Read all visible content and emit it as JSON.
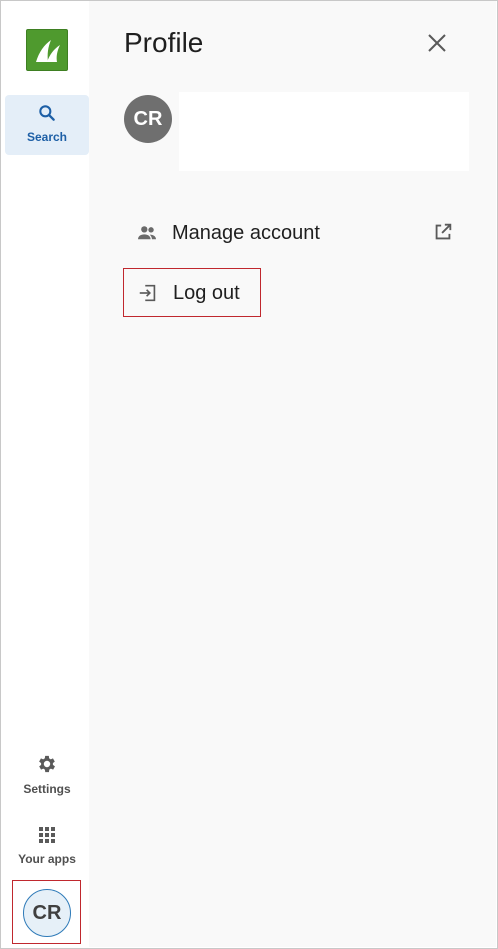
{
  "rail": {
    "logo_icon": "shark-fin-logo-icon",
    "search": {
      "icon": "search-icon",
      "label": "Search"
    },
    "settings": {
      "icon": "gear-icon",
      "label": "Settings"
    },
    "apps": {
      "icon": "grid-icon",
      "label": "Your apps"
    },
    "avatar_initials": "CR"
  },
  "panel": {
    "title": "Profile",
    "close_icon": "close-icon",
    "avatar_initials": "CR",
    "menu": [
      {
        "icon": "people-icon",
        "label": "Manage account",
        "trailing_icon": "external-link-icon"
      },
      {
        "icon": "logout-icon",
        "label": "Log out"
      }
    ]
  },
  "colors": {
    "accent": "#1d5fa6",
    "highlight": "#c0282e",
    "logo_green": "#4f9a2e"
  }
}
